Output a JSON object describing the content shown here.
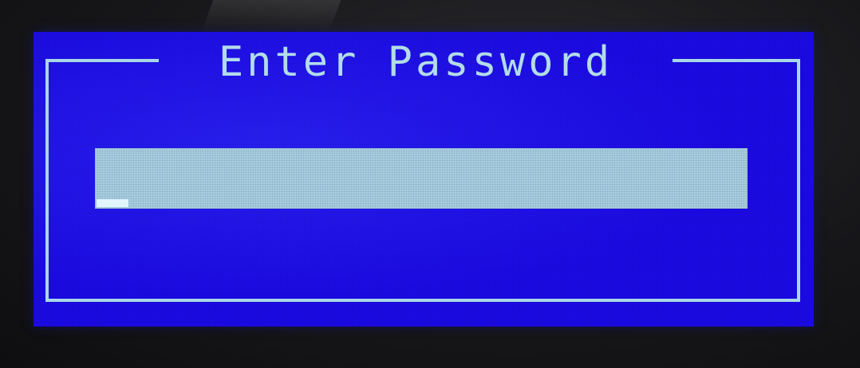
{
  "dialog": {
    "title": "Enter Password",
    "password_value": ""
  },
  "colors": {
    "screen_background": "#1c0ae6",
    "frame_and_text": "#b2dcea",
    "field_background": "#a9d0dc",
    "cursor": "#e0f6fb"
  },
  "icons": {
    "cursor": "text-cursor-block"
  }
}
